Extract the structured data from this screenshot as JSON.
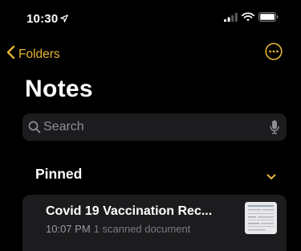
{
  "status_bar": {
    "time": "10:30",
    "icons": [
      "location-arrow-icon",
      "signal-icon",
      "wifi-icon",
      "battery-icon"
    ]
  },
  "nav": {
    "back_label": "Folders",
    "more_icon": "ellipsis-circle-icon"
  },
  "page": {
    "title": "Notes"
  },
  "search": {
    "placeholder": "Search",
    "value": ""
  },
  "sections": [
    {
      "title": "Pinned",
      "notes": [
        {
          "title": "Covid 19 Vaccination Rec...",
          "time": "10:07 PM",
          "description": "1 scanned document",
          "thumbnail_icon": "scanned-document-thumbnail"
        }
      ]
    }
  ],
  "colors": {
    "background": "#000000",
    "accent": "#e5b534",
    "field": "#1c1c1e",
    "secondary_text": "#9a9a9f"
  }
}
